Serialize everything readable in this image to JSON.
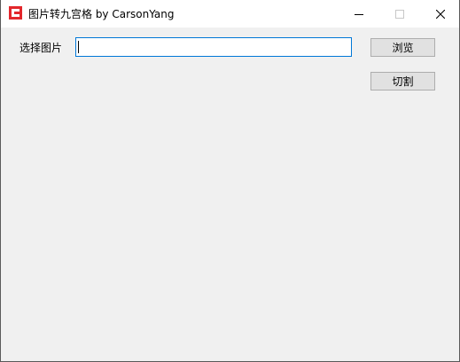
{
  "window": {
    "title": "图片转九宫格 by CarsonYang",
    "icon": "app-logo-icon",
    "controls": {
      "minimize_icon": "minimize-icon",
      "maximize_icon": "maximize-icon",
      "close_icon": "close-icon"
    }
  },
  "form": {
    "select_label": "选择图片",
    "path_input": {
      "value": "",
      "placeholder": ""
    },
    "browse_label": "浏览",
    "cut_label": "切割"
  },
  "colors": {
    "accent": "#0078d7",
    "app_icon_red": "#e3272c",
    "window_bg": "#f0f0f0",
    "button_bg": "#e1e1e1"
  }
}
